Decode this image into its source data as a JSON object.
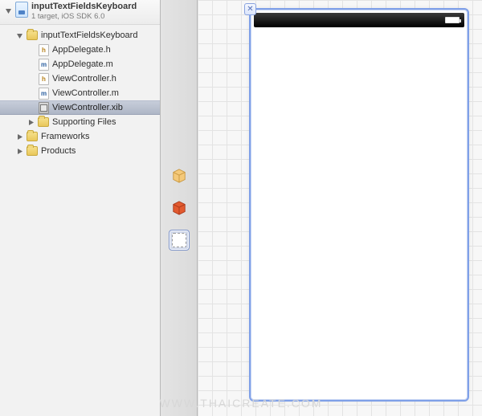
{
  "project": {
    "name": "inputTextFieldsKeyboard",
    "subtitle": "1 target, iOS SDK 6.0"
  },
  "tree": {
    "rootGroup": "inputTextFieldsKeyboard",
    "files": [
      {
        "name": "AppDelegate.h",
        "kind": "h"
      },
      {
        "name": "AppDelegate.m",
        "kind": "m"
      },
      {
        "name": "ViewController.h",
        "kind": "h"
      },
      {
        "name": "ViewController.m",
        "kind": "m"
      },
      {
        "name": "ViewController.xib",
        "kind": "xib",
        "selected": true
      }
    ],
    "groups": [
      {
        "name": "Supporting Files",
        "expanded": false
      },
      {
        "name": "Frameworks",
        "expanded": false
      },
      {
        "name": "Products",
        "expanded": false
      }
    ]
  },
  "dock": {
    "items": [
      {
        "id": "placeholder-cube-1",
        "style": "peach",
        "selected": false
      },
      {
        "id": "placeholder-cube-2",
        "style": "red",
        "selected": false
      },
      {
        "id": "view-object",
        "style": "tile",
        "selected": true
      }
    ]
  },
  "watermark": "WWW.THAICREATE.COM",
  "glyphs": {
    "h": "h",
    "m": "m"
  }
}
